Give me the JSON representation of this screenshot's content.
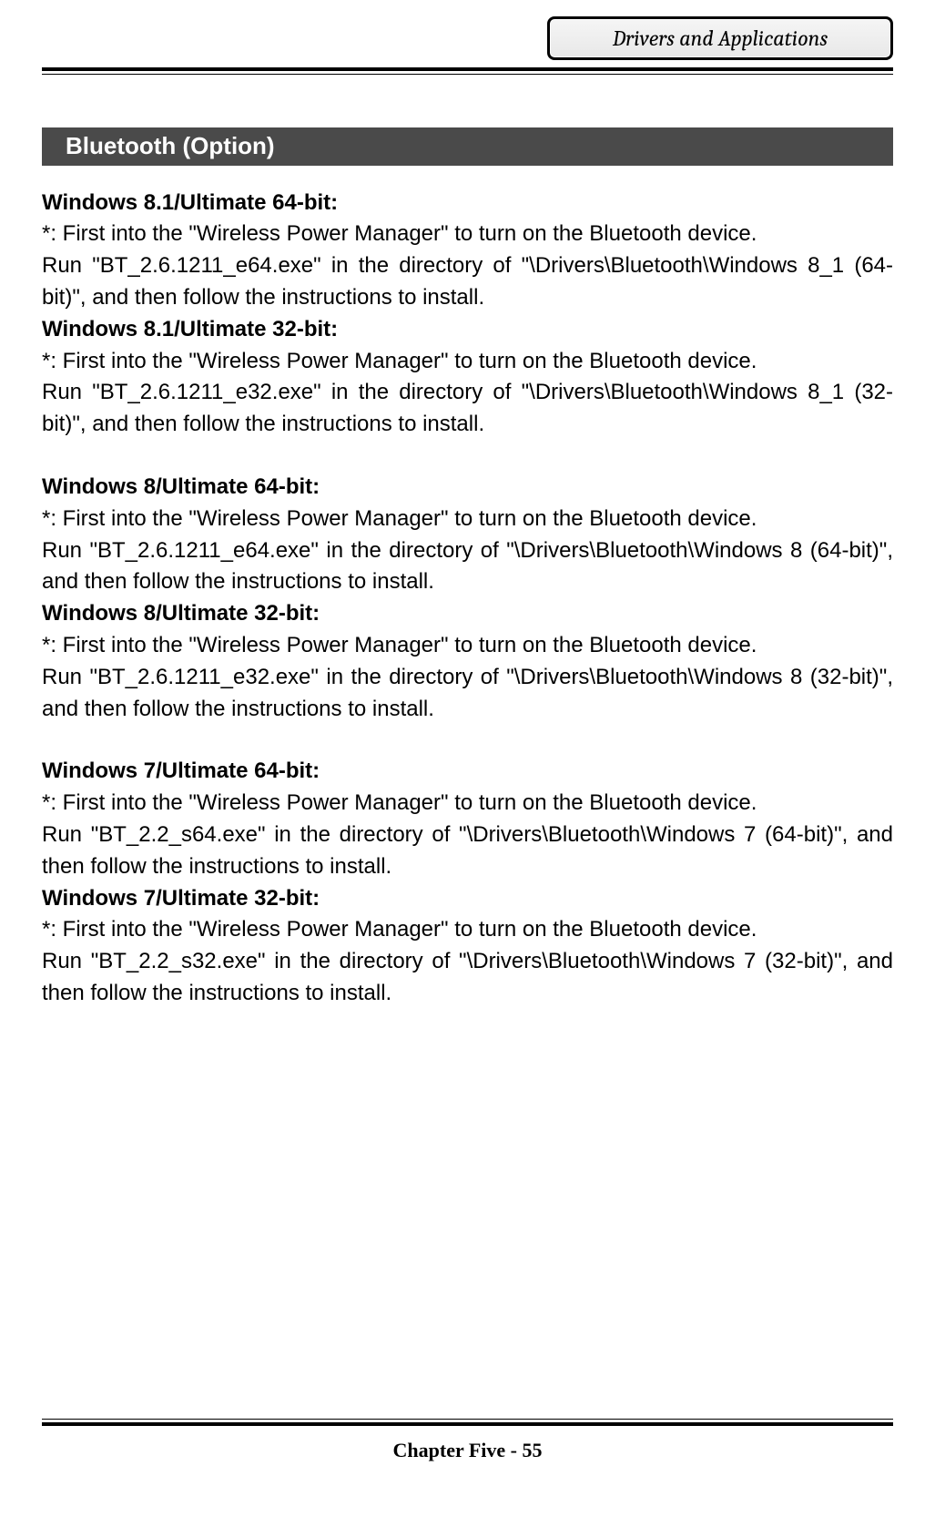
{
  "header": {
    "chapter_label": "Drivers and Applications"
  },
  "section": {
    "title": "Bluetooth (Option)"
  },
  "groups": [
    {
      "entries": [
        {
          "heading": "Windows 8.1/Ultimate 64-bit:",
          "note": "*: First into the \"Wireless Power Manager\" to turn on the Bluetooth device.",
          "body": "Run \"BT_2.6.1211_e64.exe\" in the directory of \"\\Drivers\\Bluetooth\\Windows 8_1 (64-bit)\", and then follow the instructions to install."
        },
        {
          "heading": "Windows 8.1/Ultimate 32-bit:",
          "note": "*: First into the \"Wireless Power Manager\" to turn on the Bluetooth device.",
          "body": "Run \"BT_2.6.1211_e32.exe\" in the directory of \"\\Drivers\\Bluetooth\\Windows 8_1 (32-bit)\", and then follow the instructions to install."
        }
      ]
    },
    {
      "entries": [
        {
          "heading": "Windows 8/Ultimate 64-bit:",
          "note": "*: First into the \"Wireless Power Manager\" to turn on the Bluetooth device.",
          "body": "Run \"BT_2.6.1211_e64.exe\" in the directory of \"\\Drivers\\Bluetooth\\Windows 8 (64-bit)\", and then follow the instructions to install."
        },
        {
          "heading": "Windows 8/Ultimate 32-bit:",
          "note": "*: First into the \"Wireless Power Manager\" to turn on the Bluetooth device.",
          "body": "Run \"BT_2.6.1211_e32.exe\" in the directory of \"\\Drivers\\Bluetooth\\Windows 8 (32-bit)\", and then follow the instructions to install."
        }
      ]
    },
    {
      "entries": [
        {
          "heading": "Windows 7/Ultimate 64-bit:",
          "note": "*: First into the \"Wireless Power Manager\" to turn on the Bluetooth device.",
          "body": "Run \"BT_2.2_s64.exe\" in the directory of \"\\Drivers\\Bluetooth\\Windows 7 (64-bit)\", and then follow the instructions to install."
        },
        {
          "heading": "Windows 7/Ultimate 32-bit:",
          "note": "*: First into the \"Wireless Power Manager\" to turn on the Bluetooth device.",
          "body": "Run \"BT_2.2_s32.exe\" in the directory of \"\\Drivers\\Bluetooth\\Windows 7 (32-bit)\", and then follow the instructions to install."
        }
      ]
    }
  ],
  "footer": {
    "page_label": "Chapter Five - 55"
  }
}
